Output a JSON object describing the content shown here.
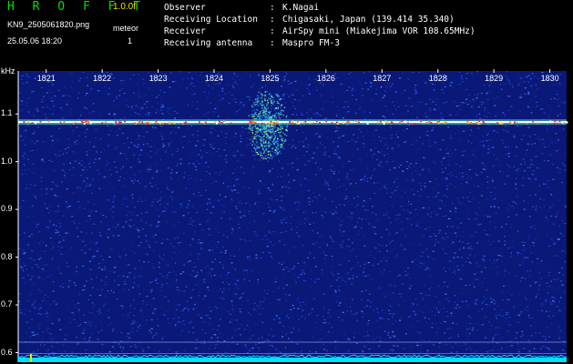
{
  "header": {
    "title": "H R O F F T",
    "version": "1.0.0f",
    "filename": "KN9_2505061820.png",
    "meteor_label": "meteor",
    "datetime": "25.05.06 18:20",
    "meteor_count": "1"
  },
  "info": {
    "rows": [
      {
        "label": "Observer",
        "value": "K.Nagai"
      },
      {
        "label": "Receiving Location",
        "value": "Chigasaki, Japan (139.414 35.340)"
      },
      {
        "label": "Receiver",
        "value": "AirSpy mini (Miakejima VOR 108.65MHz)"
      },
      {
        "label": "Receiving antenna",
        "value": "Maspro FM-3"
      }
    ]
  },
  "colors": {
    "title": "#00e000",
    "version": "#e8e800",
    "background": "#000000",
    "waterfall_base": "#0a1878",
    "carrier": "#ffffff",
    "baseline": "#00e0ff"
  },
  "chart_data": {
    "type": "heatmap",
    "y_unit": "kHz",
    "x_ticks": [
      "1821",
      "1822",
      "1823",
      "1824",
      "1825",
      "1826",
      "1827",
      "1828",
      "1829",
      "1830"
    ],
    "y_ticks": [
      "1.1",
      "1.0",
      "0.9",
      "0.8",
      "0.7",
      "0.6"
    ],
    "x_range": [
      1820.5,
      1830.3
    ],
    "y_range": [
      0.58,
      1.19
    ],
    "carrier_khz": 1.083,
    "meteor_echo": {
      "x_center": 1824.95,
      "y_center": 1.09
    }
  }
}
